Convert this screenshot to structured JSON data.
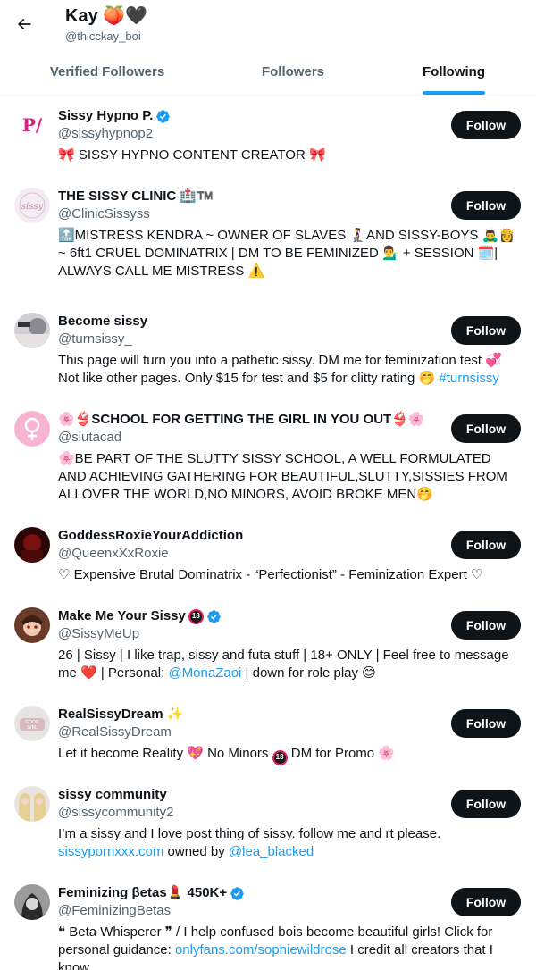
{
  "header": {
    "name": "Kay 🍑🖤",
    "handle": "@thicckay_boi"
  },
  "tabs": [
    {
      "label": "Verified Followers",
      "active": false
    },
    {
      "label": "Followers",
      "active": false
    },
    {
      "label": "Following",
      "active": true
    }
  ],
  "colors": {
    "accent": "#1d9bf0",
    "follow_button": "#0f1419",
    "secondary_text": "#536471"
  },
  "users": [
    {
      "name": "Sissy Hypno P.",
      "verified": true,
      "handle": "@sissyhypnop2",
      "button": "Follow",
      "avatar": "pink-logo",
      "bio": [
        {
          "t": "🎀 SISSY HYPNO CONTENT CREATOR 🎀"
        }
      ]
    },
    {
      "name": "THE SISSY CLINIC 🏥™️",
      "verified": false,
      "handle": "@ClinicSissyss",
      "button": "Follow",
      "avatar": "clinic-logo",
      "bio": [
        {
          "t": "🔝MISTRESS KENDRA ~ OWNER OF SLAVES 🧎‍♀️AND SISSY-BOYS 🙇‍♂️👸 ~ 6ft1 CRUEL DOMINATRIX | DM TO BE FEMINIZED 💁‍♂️ + SESSION 🗓️| ALWAYS CALL ME MISTRESS ⚠️"
        }
      ]
    },
    {
      "name": "Become sissy",
      "verified": false,
      "handle": "@turnsissy_",
      "button": "Follow",
      "avatar": "photo",
      "bio": [
        {
          "t": "This page will turn you into a pathetic sissy. DM me for feminization test 💞 Not like other pages. Only $15 for test and $5 for clitty rating 🤭 "
        },
        {
          "t": "#turnsissy",
          "link": true
        }
      ]
    },
    {
      "name": "🌸👙SCHOOL FOR GETTING THE GIRL IN YOU OUT👙🌸",
      "verified": false,
      "handle": "@slutacad",
      "button": "Follow",
      "avatar": "female-symbol",
      "bio": [
        {
          "t": "🌸BE PART OF THE SLUTTY SISSY SCHOOL, A WELL FORMULATED AND ACHIEVING GATHERING FOR BEAUTIFUL,SLUTTY,SISSIES FROM ALLOVER THE WORLD,NO MINORS, AVOID BROKE MEN🤭"
        }
      ]
    },
    {
      "name": "GoddessRoxieYourAddiction",
      "verified": false,
      "handle": "@QueenxXxRoxie",
      "button": "Follow",
      "avatar": "dark-red",
      "bio": [
        {
          "t": "♡ Expensive Brutal Dominatrix - “Perfectionist” - Feminization Expert ♡"
        }
      ]
    },
    {
      "name": "Make Me Your Sissy",
      "verified": true,
      "r18": true,
      "handle": "@SissyMeUp",
      "button": "Follow",
      "avatar": "anime",
      "bio": [
        {
          "t": "26 | Sissy | I like trap, sissy and futa stuff | 18+ ONLY | Feel free to message me ❤️ | Personal: "
        },
        {
          "t": "@MonaZaoi",
          "link": true
        },
        {
          "t": " | down for role play 😊"
        }
      ]
    },
    {
      "name": "RealSissyDream ✨",
      "verified": false,
      "handle": "@RealSissyDream",
      "button": "Follow",
      "avatar": "good-girl",
      "bio": [
        {
          "t": "Let it become Reality 💖 No Minors "
        },
        {
          "r18": true
        },
        {
          "t": " DM for Promo 🌸"
        }
      ]
    },
    {
      "name": "sissy community",
      "verified": false,
      "handle": "@sissycommunity2",
      "button": "Follow",
      "avatar": "blonde",
      "bio": [
        {
          "t": "I’m a sissy and I love post thing of sissy. follow me and rt please. "
        },
        {
          "t": "sissypornxxx.com",
          "link": true
        },
        {
          "t": " owned by "
        },
        {
          "t": "@lea_blacked",
          "link": true
        }
      ]
    },
    {
      "name": "Feminizing βetas💄 450K+",
      "verified": true,
      "handle": "@FeminizingBetas",
      "button": "Follow",
      "avatar": "gray-portrait",
      "bio": [
        {
          "t": "❝ Beta Whisperer ❞ / I help confused bois become beautiful girls! Click for personal guidance: "
        },
        {
          "t": "onlyfans.com/sophiewildrose",
          "link": true
        },
        {
          "t": " I credit all creators that I know."
        }
      ]
    }
  ]
}
